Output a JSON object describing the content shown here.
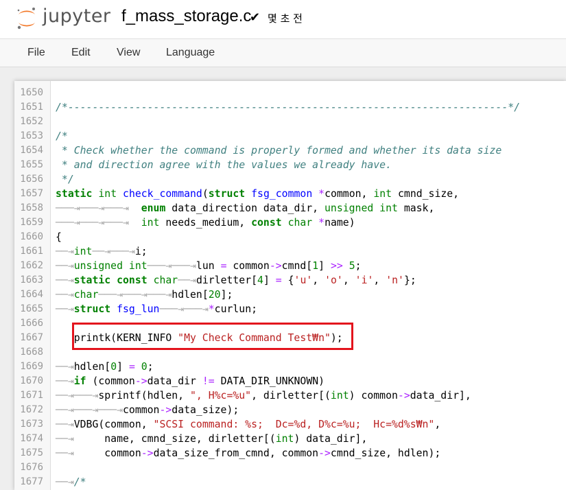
{
  "header": {
    "brand": "jupyter",
    "filename": "f_mass_storage.c",
    "checkmark": "✔",
    "save_status": "몇 초 전"
  },
  "menu": {
    "file": "File",
    "edit": "Edit",
    "view": "View",
    "language": "Language"
  },
  "colors": {
    "logo_orange": "#f37726",
    "logo_gray": "#767677",
    "highlight_border": "#e3141d",
    "comment": "#408080",
    "keyword": "#008000",
    "function": "#0000ff",
    "string": "#ba2121",
    "operator": "#aa22ff"
  },
  "editor": {
    "lines": [
      {
        "num": "1650",
        "segs": []
      },
      {
        "num": "1651",
        "segs": [
          {
            "t": "cm",
            "v": "/*------------------------------------------------------------------------*/"
          }
        ]
      },
      {
        "num": "1652",
        "segs": []
      },
      {
        "num": "1653",
        "segs": [
          {
            "t": "cm",
            "v": "/*"
          }
        ]
      },
      {
        "num": "1654",
        "segs": [
          {
            "t": "cm",
            "v": " * Check whether the command is properly formed and whether its data size"
          }
        ]
      },
      {
        "num": "1655",
        "segs": [
          {
            "t": "cm",
            "v": " * and direction agree with the values we already have."
          }
        ]
      },
      {
        "num": "1656",
        "segs": [
          {
            "t": "cm",
            "v": " */"
          }
        ]
      },
      {
        "num": "1657",
        "segs": [
          {
            "t": "kw",
            "v": "static"
          },
          {
            "t": "",
            "v": " "
          },
          {
            "t": "ty",
            "v": "int"
          },
          {
            "t": "",
            "v": " "
          },
          {
            "t": "fn",
            "v": "check_command"
          },
          {
            "t": "",
            "v": "("
          },
          {
            "t": "kw",
            "v": "struct"
          },
          {
            "t": "",
            "v": " "
          },
          {
            "t": "fn",
            "v": "fsg_common"
          },
          {
            "t": "",
            "v": " "
          },
          {
            "t": "op",
            "v": "*"
          },
          {
            "t": "",
            "v": "common, "
          },
          {
            "t": "ty",
            "v": "int"
          },
          {
            "t": "",
            "v": " cmnd_size,"
          }
        ]
      },
      {
        "num": "1658",
        "segs": [
          {
            "t": "ts",
            "v": "───⇥───⇥───⇥ "
          },
          {
            "t": "",
            "v": " "
          },
          {
            "t": "kw",
            "v": "enum"
          },
          {
            "t": "",
            "v": " data_direction data_dir, "
          },
          {
            "t": "ty",
            "v": "unsigned int"
          },
          {
            "t": "",
            "v": " mask,"
          }
        ]
      },
      {
        "num": "1659",
        "segs": [
          {
            "t": "ts",
            "v": "───⇥───⇥───⇥ "
          },
          {
            "t": "",
            "v": " "
          },
          {
            "t": "ty",
            "v": "int"
          },
          {
            "t": "",
            "v": " needs_medium, "
          },
          {
            "t": "kw",
            "v": "const"
          },
          {
            "t": "",
            "v": " "
          },
          {
            "t": "ty",
            "v": "char"
          },
          {
            "t": "",
            "v": " "
          },
          {
            "t": "op",
            "v": "*"
          },
          {
            "t": "",
            "v": "name)"
          }
        ]
      },
      {
        "num": "1660",
        "segs": [
          {
            "t": "",
            "v": "{"
          }
        ]
      },
      {
        "num": "1661",
        "segs": [
          {
            "t": "ts",
            "v": "──⇥"
          },
          {
            "t": "ty",
            "v": "int"
          },
          {
            "t": "ts",
            "v": "──⇥───⇥"
          },
          {
            "t": "",
            "v": "i;"
          }
        ]
      },
      {
        "num": "1662",
        "segs": [
          {
            "t": "ts",
            "v": "──⇥"
          },
          {
            "t": "ty",
            "v": "unsigned int"
          },
          {
            "t": "ts",
            "v": "───⇥───⇥"
          },
          {
            "t": "",
            "v": "lun "
          },
          {
            "t": "op",
            "v": "="
          },
          {
            "t": "",
            "v": " common"
          },
          {
            "t": "op",
            "v": "->"
          },
          {
            "t": "",
            "v": "cmnd["
          },
          {
            "t": "nu",
            "v": "1"
          },
          {
            "t": "",
            "v": "] "
          },
          {
            "t": "op",
            "v": ">>"
          },
          {
            "t": "",
            "v": " "
          },
          {
            "t": "nu",
            "v": "5"
          },
          {
            "t": "",
            "v": ";"
          }
        ]
      },
      {
        "num": "1663",
        "segs": [
          {
            "t": "ts",
            "v": "──⇥"
          },
          {
            "t": "kw",
            "v": "static const"
          },
          {
            "t": "",
            "v": " "
          },
          {
            "t": "ty",
            "v": "char"
          },
          {
            "t": "ts",
            "v": "──⇥"
          },
          {
            "t": "",
            "v": "dirletter["
          },
          {
            "t": "nu",
            "v": "4"
          },
          {
            "t": "",
            "v": "] "
          },
          {
            "t": "op",
            "v": "="
          },
          {
            "t": "",
            "v": " {"
          },
          {
            "t": "st",
            "v": "'u'"
          },
          {
            "t": "",
            "v": ", "
          },
          {
            "t": "st",
            "v": "'o'"
          },
          {
            "t": "",
            "v": ", "
          },
          {
            "t": "st",
            "v": "'i'"
          },
          {
            "t": "",
            "v": ", "
          },
          {
            "t": "st",
            "v": "'n'"
          },
          {
            "t": "",
            "v": "};"
          }
        ]
      },
      {
        "num": "1664",
        "segs": [
          {
            "t": "ts",
            "v": "──⇥"
          },
          {
            "t": "ty",
            "v": "char"
          },
          {
            "t": "ts",
            "v": "───⇥───⇥───⇥"
          },
          {
            "t": "",
            "v": "hdlen["
          },
          {
            "t": "nu",
            "v": "20"
          },
          {
            "t": "",
            "v": "];"
          }
        ]
      },
      {
        "num": "1665",
        "segs": [
          {
            "t": "ts",
            "v": "──⇥"
          },
          {
            "t": "kw",
            "v": "struct"
          },
          {
            "t": "",
            "v": " "
          },
          {
            "t": "fn",
            "v": "fsg_lun"
          },
          {
            "t": "ts",
            "v": "───⇥───⇥"
          },
          {
            "t": "op",
            "v": "*"
          },
          {
            "t": "",
            "v": "curlun;"
          }
        ]
      },
      {
        "num": "1666",
        "segs": []
      },
      {
        "num": "1667",
        "segs": [
          {
            "t": "",
            "v": "   printk(KERN_INFO "
          },
          {
            "t": "st",
            "v": "\"My Check Command Test₩n\""
          },
          {
            "t": "",
            "v": ");"
          }
        ]
      },
      {
        "num": "1668",
        "segs": []
      },
      {
        "num": "1669",
        "segs": [
          {
            "t": "ts",
            "v": "──⇥"
          },
          {
            "t": "",
            "v": "hdlen["
          },
          {
            "t": "nu",
            "v": "0"
          },
          {
            "t": "",
            "v": "] "
          },
          {
            "t": "op",
            "v": "="
          },
          {
            "t": "",
            "v": " "
          },
          {
            "t": "nu",
            "v": "0"
          },
          {
            "t": "",
            "v": ";"
          }
        ]
      },
      {
        "num": "1670",
        "segs": [
          {
            "t": "ts",
            "v": "──⇥"
          },
          {
            "t": "kw",
            "v": "if"
          },
          {
            "t": "",
            "v": " (common"
          },
          {
            "t": "op",
            "v": "->"
          },
          {
            "t": "",
            "v": "data_dir "
          },
          {
            "t": "op",
            "v": "!="
          },
          {
            "t": "",
            "v": " DATA_DIR_UNKNOWN)"
          }
        ]
      },
      {
        "num": "1671",
        "segs": [
          {
            "t": "ts",
            "v": "──⇥───⇥"
          },
          {
            "t": "",
            "v": "sprintf(hdlen, "
          },
          {
            "t": "st",
            "v": "\", H%c=%u\""
          },
          {
            "t": "",
            "v": ", dirletter[("
          },
          {
            "t": "ty",
            "v": "int"
          },
          {
            "t": "",
            "v": ") common"
          },
          {
            "t": "op",
            "v": "->"
          },
          {
            "t": "",
            "v": "data_dir],"
          }
        ]
      },
      {
        "num": "1672",
        "segs": [
          {
            "t": "ts",
            "v": "──⇥───⇥───⇥"
          },
          {
            "t": "",
            "v": "common"
          },
          {
            "t": "op",
            "v": "->"
          },
          {
            "t": "",
            "v": "data_size);"
          }
        ]
      },
      {
        "num": "1673",
        "segs": [
          {
            "t": "ts",
            "v": "──⇥"
          },
          {
            "t": "",
            "v": "VDBG(common, "
          },
          {
            "t": "st",
            "v": "\"SCSI command: %s;  Dc=%d, D%c=%u;  Hc=%d%s₩n\""
          },
          {
            "t": "",
            "v": ","
          }
        ]
      },
      {
        "num": "1674",
        "segs": [
          {
            "t": "ts",
            "v": "──⇥"
          },
          {
            "t": "",
            "v": "     name, cmnd_size, dirletter[("
          },
          {
            "t": "ty",
            "v": "int"
          },
          {
            "t": "",
            "v": ") data_dir],"
          }
        ]
      },
      {
        "num": "1675",
        "segs": [
          {
            "t": "ts",
            "v": "──⇥"
          },
          {
            "t": "",
            "v": "     common"
          },
          {
            "t": "op",
            "v": "->"
          },
          {
            "t": "",
            "v": "data_size_from_cmnd, common"
          },
          {
            "t": "op",
            "v": "->"
          },
          {
            "t": "",
            "v": "cmnd_size, hdlen);"
          }
        ]
      },
      {
        "num": "1676",
        "segs": []
      },
      {
        "num": "1677",
        "segs": [
          {
            "t": "ts",
            "v": "──⇥"
          },
          {
            "t": "cm",
            "v": "/*"
          }
        ]
      }
    ]
  }
}
